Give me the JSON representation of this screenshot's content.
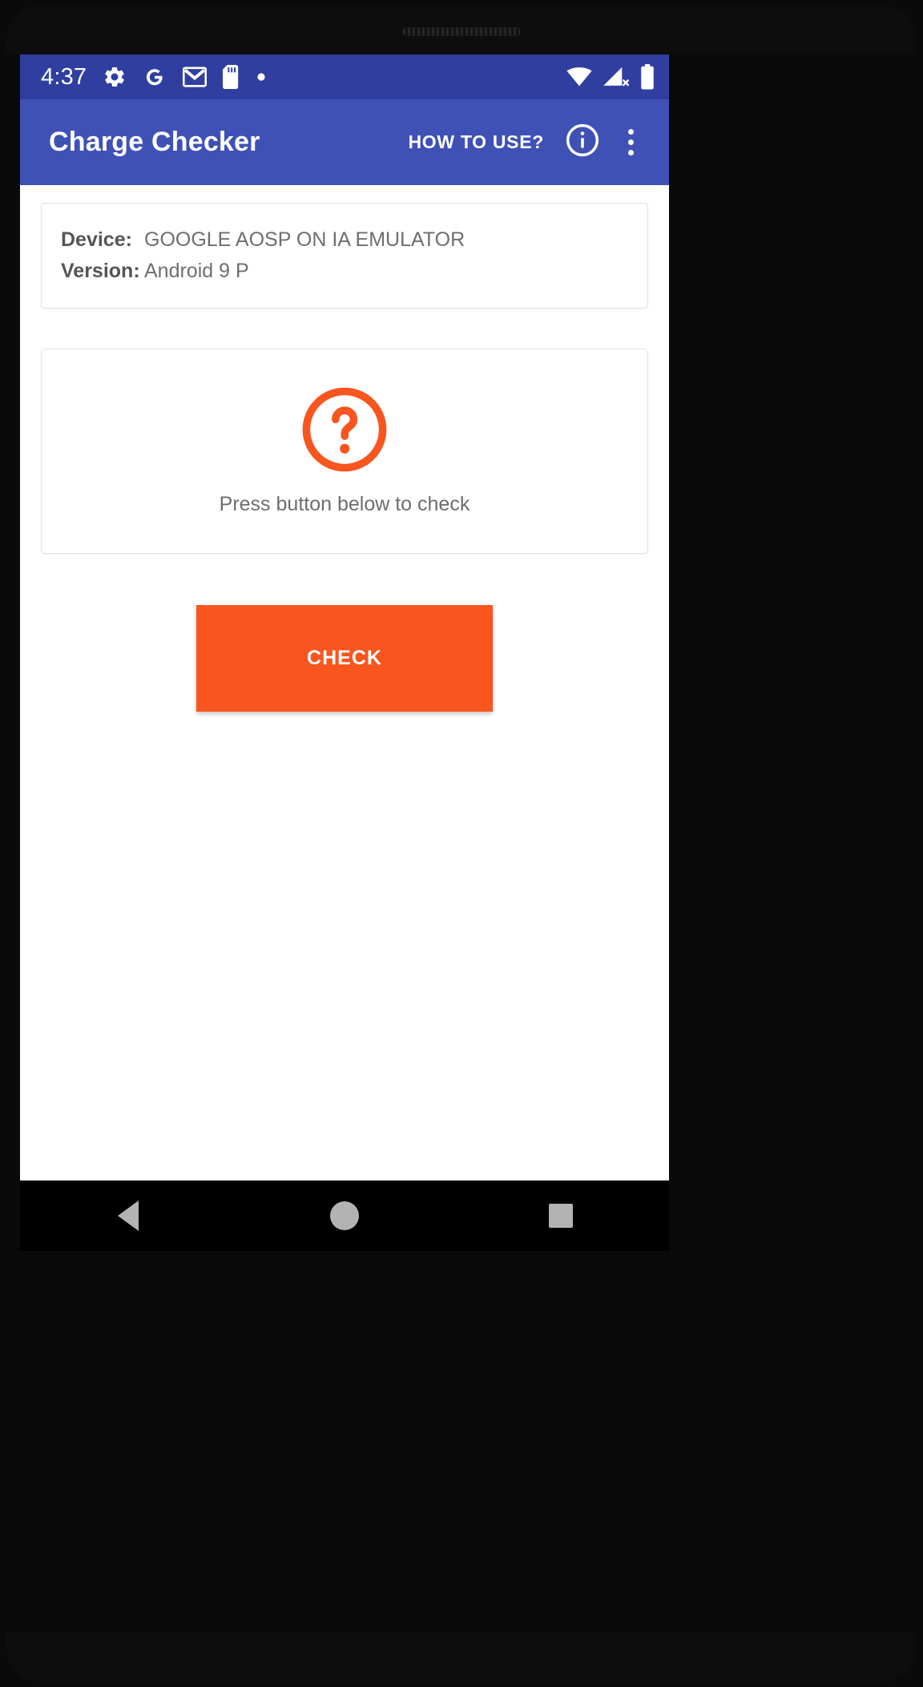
{
  "status_bar": {
    "time": "4:37",
    "left_icons": [
      {
        "name": "settings-gear-icon",
        "label": "settings"
      },
      {
        "name": "google-g-icon",
        "label": "google"
      },
      {
        "name": "gmail-icon",
        "label": "gmail"
      },
      {
        "name": "sd-card-icon",
        "label": "sd card"
      },
      {
        "name": "dot-icon",
        "label": "more notifications"
      }
    ],
    "right_icons": [
      {
        "name": "wifi-icon",
        "label": "wifi full"
      },
      {
        "name": "cellular-signal-off-icon",
        "label": "no sim"
      },
      {
        "name": "battery-icon",
        "label": "battery full"
      }
    ],
    "background_color": "#303f9f"
  },
  "app_bar": {
    "title": "Charge Checker",
    "how_to_use_label": "HOW TO USE?",
    "info_icon": "info-circle-icon",
    "overflow_icon": "overflow-menu-icon",
    "background_color": "#3f51b5"
  },
  "device_info": {
    "rows": [
      {
        "label": "Device:",
        "value": "GOOGLE AOSP ON IA EMULATOR"
      },
      {
        "label": "Version:",
        "value": "Android 9 P"
      }
    ]
  },
  "status_card": {
    "icon": "question-mark-circle-icon",
    "icon_color": "#f9551f",
    "message": "Press button below to check"
  },
  "check_button": {
    "label": "CHECK",
    "color": "#f9551f"
  },
  "nav_bar": {
    "back": "back-triangle-icon",
    "home": "home-circle-icon",
    "recents": "recents-square-icon"
  }
}
